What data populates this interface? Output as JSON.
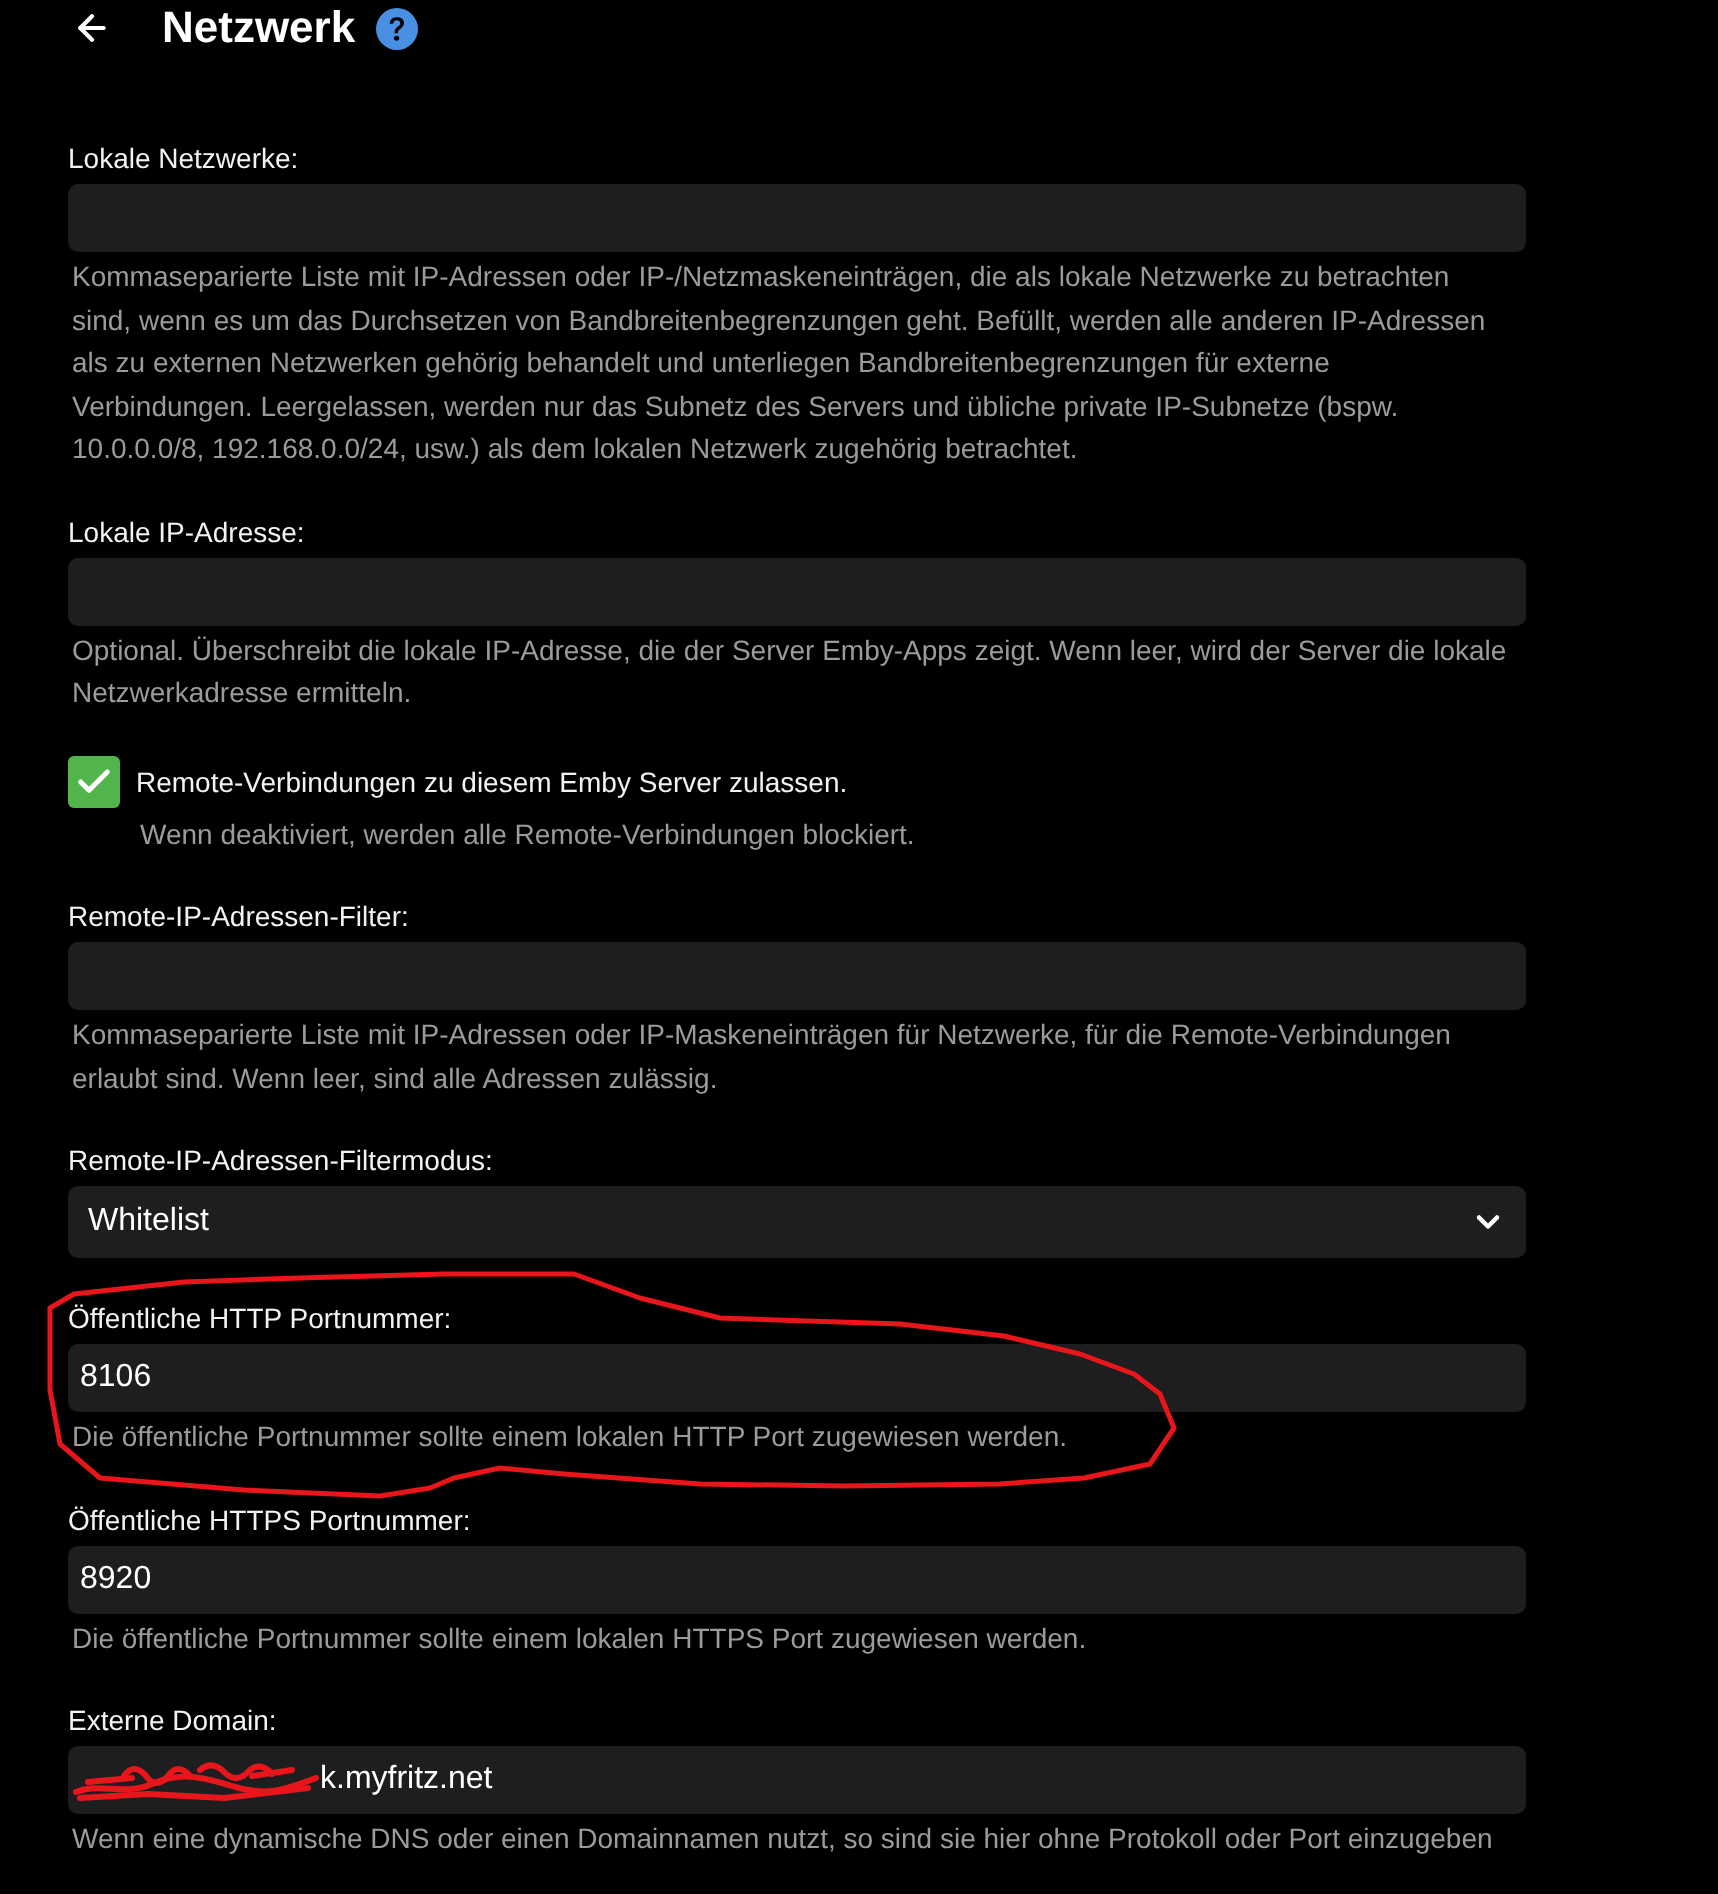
{
  "header": {
    "title": "Netzwerk"
  },
  "settings": [
    {
      "kind": "text",
      "label": "Lokale Netzwerke:",
      "description": "Kommaseparierte Liste mit IP-Adressen oder IP-/Netzmaskeneinträgen, die als lokale Netzwerke zu betrachten sind, wenn es um das Durchsetzen von Bandbreitenbegrenzungen geht. Befüllt, werden alle anderen IP-Adressen als zu externen Netzwerken gehörig behandelt und unterliegen Bandbreitenbegrenzungen für externe Verbindungen. Leergelassen, werden nur das Subnetz des Servers und übliche private IP-Subnetze (bspw. 10.0.0.0/8, 192.168.0.0/24, usw.) als dem lokalen Netzwerk zugehörig betrachtet.",
      "circled": false,
      "redacted": false
    },
    {
      "kind": "text",
      "label": "Lokale IP-Adresse:",
      "description": "Optional. Überschreibt die lokale IP-Adresse, die der Server Emby-Apps zeigt. Wenn leer, wird der Server die lokale Netzwerkadresse ermitteln.",
      "circled": false,
      "redacted": false
    },
    {
      "kind": "checkbox",
      "label": "Remote-Verbindungen zu diesem Emby Server zulassen.",
      "checked": true,
      "description": "Wenn deaktiviert, werden alle Remote-Verbindungen blockiert.",
      "circled": false,
      "redacted": false
    },
    {
      "kind": "text",
      "label": "Remote-IP-Adressen-Filter:",
      "description": "Kommaseparierte Liste mit IP-Adressen oder IP-Maskeneinträgen für Netzwerke, für die Remote-Verbindungen erlaubt sind. Wenn leer, sind alle Adressen zulässig.",
      "circled": false,
      "redacted": false
    },
    {
      "kind": "select",
      "label": "Remote-IP-Adressen-Filtermodus:",
      "value": "Whitelist",
      "circled": false,
      "redacted": false
    },
    {
      "kind": "text",
      "label": "Öffentliche HTTP Portnummer:",
      "value": "8106",
      "description": "Die öffentliche Portnummer sollte einem lokalen HTTP Port zugewiesen werden.",
      "circled": true,
      "redacted": false
    },
    {
      "kind": "text",
      "label": "Öffentliche HTTPS Portnummer:",
      "value": "8920",
      "description": "Die öffentliche Portnummer sollte einem lokalen HTTPS Port zugewiesen werden.",
      "circled": false,
      "redacted": false
    },
    {
      "kind": "text",
      "label": "Externe Domain:",
      "value": "k.myfritz.net",
      "description": "Wenn eine dynamische DNS oder einen Domainnamen nutzt, so sind sie hier ohne Protokoll oder Port einzugeben",
      "circled": false,
      "redacted": true
    }
  ]
}
